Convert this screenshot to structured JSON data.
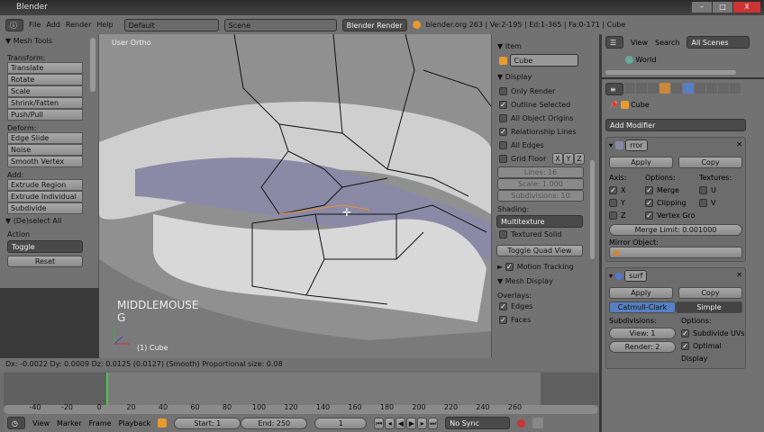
{
  "window": {
    "title": "Blender",
    "min": "–",
    "max": "□",
    "close": "X"
  },
  "menubar": {
    "menus": [
      "File",
      "Add",
      "Render",
      "Help"
    ],
    "layout": "Default",
    "scene": "Scene",
    "engine": "Blender Render",
    "stats": "blender.org 263 | Ve:2-195 | Ed:1-365 | Fa:0-171 | Cube"
  },
  "toolshelf": {
    "title": "Mesh Tools",
    "transform_label": "Transform:",
    "transform": [
      "Translate",
      "Rotate",
      "Scale",
      "Shrink/Fatten",
      "Push/Pull"
    ],
    "deform_label": "Deform:",
    "deform": [
      "Edge Slide",
      "Noise",
      "Smooth Vertex"
    ],
    "add_label": "Add:",
    "add": [
      "Extrude Region",
      "Extrude Individual",
      "Subdivide"
    ],
    "operator_title": "(De)select All",
    "action_label": "Action",
    "action_value": "Toggle",
    "reset": "Reset"
  },
  "viewport": {
    "view_name": "User Ortho",
    "overlay_line1": "MIDDLEMOUSE",
    "overlay_line2": "G",
    "object_label": "(1) Cube"
  },
  "npanel": {
    "item_title": "Item",
    "item_name": "Cube",
    "display_title": "Display",
    "only_render": "Only Render",
    "outline_selected": "Outline Selected",
    "all_object_origins": "All Object Origins",
    "relationship_lines": "Relationship Lines",
    "all_edges": "All Edges",
    "grid_floor": "Grid Floor",
    "x": "X",
    "y": "Y",
    "z": "Z",
    "lines": "Lines: 16",
    "scale": "Scale: 1.000",
    "subdivisions": "Subdivisions: 10",
    "shading_label": "Shading:",
    "shading_value": "Multitexture",
    "textured_solid": "Textured Solid",
    "toggle_quad": "Toggle Quad View",
    "motion_tracking": "Motion Tracking",
    "mesh_display": "Mesh Display",
    "overlays": "Overlays:",
    "edges": "Edges",
    "faces": "Faces"
  },
  "outliner": {
    "view": "View",
    "search": "Search",
    "scenes": "All Scenes",
    "world": "World"
  },
  "properties": {
    "object": "Cube",
    "add_modifier": "Add Modifier",
    "mirror": {
      "name": "rror",
      "apply": "Apply",
      "copy": "Copy",
      "axis": "Axis:",
      "options": "Options:",
      "textures": "Textures:",
      "x": "X",
      "y": "Y",
      "z": "Z",
      "merge": "Merge",
      "clipping": "Clipping",
      "vertex_gro": "Vertex Gro",
      "u": "U",
      "v": "V",
      "merge_limit": "Merge Limit: 0.001000",
      "mirror_object": "Mirror Object:"
    },
    "subsurf": {
      "name": "surf",
      "apply": "Apply",
      "copy": "Copy",
      "catmull": "Catmull-Clark",
      "simple": "Simple",
      "subdivisions": "Subdivisions:",
      "options": "Options:",
      "view": "View: 1",
      "render": "Render: 2",
      "subdivide_uvs": "Subdivide UVs",
      "optimal_display": "Optimal Display"
    }
  },
  "status": {
    "text": "Dx: -0.0022  Dy: 0.0009  Dz: 0.0125 (0.0127) (Smooth)  Proportional size: 0.08"
  },
  "timeline": {
    "ticks": [
      "-40",
      "-20",
      "0",
      "20",
      "40",
      "60",
      "80",
      "100",
      "120",
      "140",
      "160",
      "180",
      "200",
      "220",
      "240",
      "260"
    ],
    "menus": [
      "View",
      "Marker",
      "Frame",
      "Playback"
    ],
    "start": "Start: 1",
    "end": "End: 250",
    "current": "1",
    "sync": "No Sync",
    "current_frame": 0
  },
  "colors": {
    "accent": "#5680c2",
    "playhead": "#44cc44"
  }
}
